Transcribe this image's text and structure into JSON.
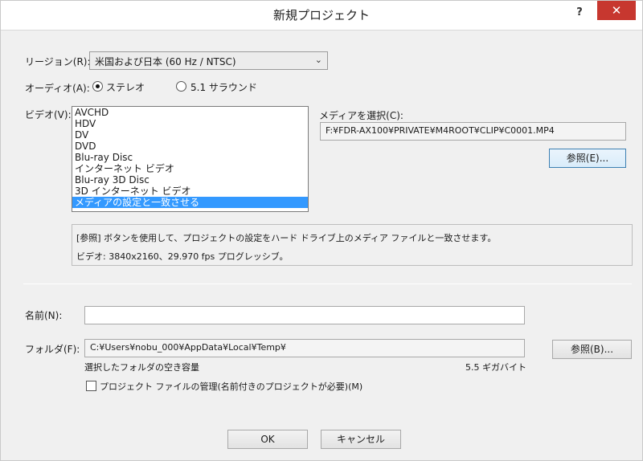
{
  "window": {
    "title": "新規プロジェクト",
    "help_label": "?",
    "close_label": "✕"
  },
  "region": {
    "label": "リージョン(R):",
    "selected": "米国および日本 (60 Hz / NTSC)"
  },
  "audio": {
    "label": "オーディオ(A):",
    "options": [
      {
        "label": "ステレオ",
        "checked": true
      },
      {
        "label": "5.1 サラウンド",
        "checked": false
      }
    ]
  },
  "video": {
    "label": "ビデオ(V):",
    "items": [
      {
        "label": "AVCHD",
        "selected": false
      },
      {
        "label": "HDV",
        "selected": false
      },
      {
        "label": "DV",
        "selected": false
      },
      {
        "label": "DVD",
        "selected": false
      },
      {
        "label": "Blu-ray Disc",
        "selected": false
      },
      {
        "label": "インターネット ビデオ",
        "selected": false
      },
      {
        "label": "Blu-ray 3D Disc",
        "selected": false
      },
      {
        "label": "3D インターネット ビデオ",
        "selected": false
      },
      {
        "label": "メディアの設定と一致させる",
        "selected": true
      }
    ]
  },
  "media": {
    "label": "メディアを選択(C):",
    "path": "F:¥FDR-AX100¥PRIVATE¥M4ROOT¥CLIP¥C0001.MP4",
    "browse_label": "参照(E)..."
  },
  "info": {
    "line1": "[参照] ボタンを使用して、プロジェクトの設定をハード ドライブ上のメディア ファイルと一致させます。",
    "line2": "ビデオ: 3840x2160、29.970 fps プログレッシブ。"
  },
  "name": {
    "label": "名前(N):",
    "value": ""
  },
  "folder": {
    "label": "フォルダ(F):",
    "path": "C:¥Users¥nobu_000¥AppData¥Local¥Temp¥",
    "browse_label": "参照(B)...",
    "free_space_label": "選択したフォルダの空き容量",
    "free_space_value": "5.5 ギガバイト"
  },
  "manage_files": {
    "label": "プロジェクト ファイルの管理(名前付きのプロジェクトが必要)(M)",
    "checked": false
  },
  "footer": {
    "ok_label": "OK",
    "cancel_label": "キャンセル"
  }
}
